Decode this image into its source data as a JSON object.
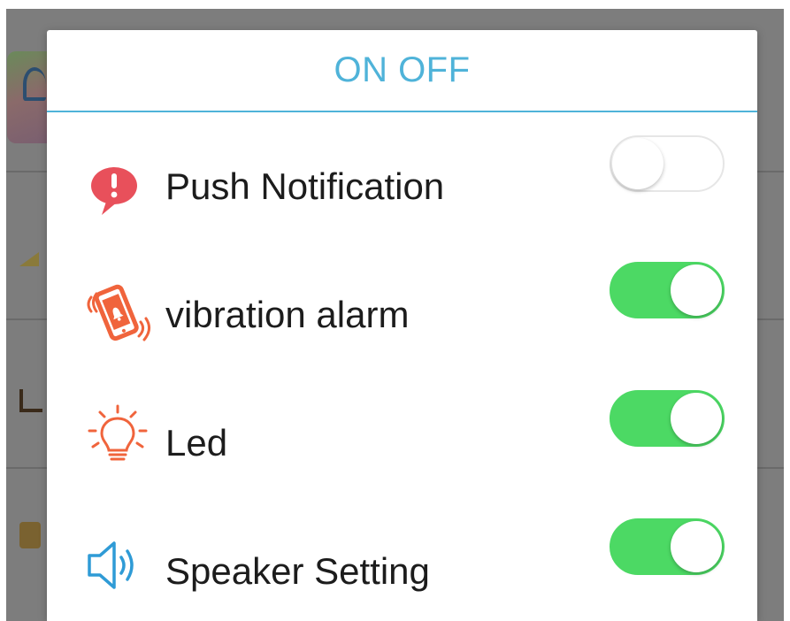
{
  "dialog": {
    "title": "ON OFF"
  },
  "settings": [
    {
      "label": "Push Notification",
      "icon": "alert-bubble-icon",
      "enabled": false
    },
    {
      "label": "vibration alarm",
      "icon": "vibrating-phone-icon",
      "enabled": true
    },
    {
      "label": "Led",
      "icon": "light-bulb-icon",
      "enabled": true
    },
    {
      "label": "Speaker Setting",
      "icon": "speaker-icon",
      "enabled": true
    }
  ],
  "colors": {
    "accent": "#4fb3d9",
    "toggle_on": "#4cd964",
    "alert_icon": "#e8505b",
    "orange_icon": "#f0643c",
    "speaker_icon": "#2f9bd6"
  }
}
